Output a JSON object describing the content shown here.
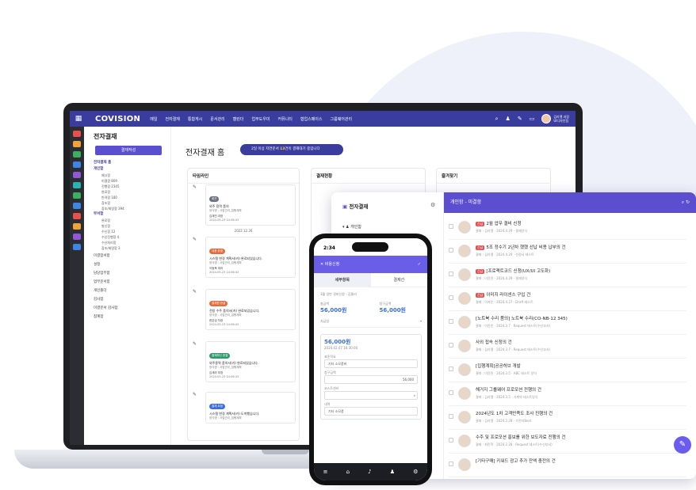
{
  "topbar": {
    "logo": "COVISION",
    "menu": [
      "메일",
      "전자결재",
      "통합게시",
      "문서관리",
      "캘린더",
      "업무도우미",
      "커뮤니티",
      "협업스페이스",
      "그룹웨어관리"
    ],
    "user_name": "김라엘 과장",
    "user_dept": "UI디자인팀"
  },
  "sidebar": {
    "title": "전자결재",
    "compose": "결재작성",
    "items": [
      {
        "label": "전자결재 홈",
        "cls": "grp"
      },
      {
        "label": "개인함",
        "cls": "grp"
      },
      {
        "label": "예고함",
        "cls": "sub"
      },
      {
        "label": "미결함 809",
        "cls": "sub"
      },
      {
        "label": "진행함 2345",
        "cls": "sub"
      },
      {
        "label": "완료함",
        "cls": "sub"
      },
      {
        "label": "반려함 180",
        "cls": "sub"
      },
      {
        "label": "참조함",
        "cls": "sub"
      },
      {
        "label": "참조/회람함 394",
        "cls": "sub"
      },
      {
        "label": "부서함",
        "cls": "grp"
      },
      {
        "label": "완료함",
        "cls": "sub"
      },
      {
        "label": "발신함",
        "cls": "sub"
      },
      {
        "label": "수신함 12",
        "cls": "sub"
      },
      {
        "label": "수신진행함 4",
        "cls": "sub"
      },
      {
        "label": "수신처리함",
        "cls": "sub"
      },
      {
        "label": "참조/회람함 3",
        "cls": "sub"
      },
      {
        "label": "미결함서함",
        "cls": ""
      },
      {
        "label": "설정",
        "cls": ""
      },
      {
        "label": "담당업무함",
        "cls": ""
      },
      {
        "label": "업무문서함",
        "cls": ""
      },
      {
        "label": "개인폴더",
        "cls": ""
      },
      {
        "label": "감사함",
        "cls": ""
      },
      {
        "label": "미결문서 감사함",
        "cls": ""
      },
      {
        "label": "참계함",
        "cls": ""
      }
    ]
  },
  "main": {
    "title": "전자결재 홈",
    "banner_pre": "2일 이상 지연문서 ",
    "banner_num": "13",
    "banner_post": "건이 결재대기 중입니다"
  },
  "timeline": {
    "title": "타임라인",
    "today": "TODAY",
    "date2": "2022.12.26",
    "items": [
      {
        "badge": "회관",
        "color": "#6b7180",
        "title": "외주 용역 품의",
        "sub": "양식명 : 사업관리_집행계획",
        "name": "김재진 과장",
        "time": "2024-05-23 14:56:43"
      },
      {
        "badge": "내용 완결",
        "color": "#e56b3c",
        "title": "시스템 변경 계획서(카) 완료되었습니다.",
        "sub": "양식명 : 사업관리_집행계획",
        "name": "이동욱 대리",
        "time": "2024-05-23 14:56:43"
      },
      {
        "badge": "결재원 완결",
        "color": "#e56b3c",
        "title": "전용 수주 품의서(카) 완료되었습니다.",
        "sub": "양식명 : 사업관리_집행계획",
        "name": "한은성 차장",
        "time": "2024-05-23 14:56:43"
      },
      {
        "badge": "결재하신 완결",
        "color": "#2e9a6c",
        "title": "외주용역 품의서(카) 완료되었습니다.",
        "sub": "양식명 : 사업관리_집행계획",
        "name": "김세라 부장",
        "time": "2024-05-23 14:56:43"
      },
      {
        "badge": "결재 요청",
        "color": "#3b6fe0",
        "title": "시스템 변경 계획서(카) 도착했습니다.",
        "sub": "양식명 : 사업관리_집행계획",
        "name": "",
        "time": ""
      }
    ]
  },
  "cards": {
    "approval": "결재현황",
    "favorites": "즐겨찾기"
  },
  "panel": {
    "left_title": "전자결재",
    "left_item": "개인함",
    "header": "개인함 - 미결함",
    "rows": [
      {
        "tag": "긴급",
        "title": "2월 업무 결비 신청",
        "meta": "결재 : 김라엘 · 2024.4.29 · 결재양식"
      },
      {
        "tag": "긴급",
        "title": "5조 정수기 2년차 했했 선납 비용 납부의 건",
        "meta": "결재 : 김라엘 · 2024.4.29 · 선정서 테스트"
      },
      {
        "tag": "긴급",
        "title": "[프로젝트코드 신청(UX/UI 고도화)",
        "meta": "결재 : 이윤민 · 2024.4.29 · 결재양식"
      },
      {
        "tag": "긴급",
        "title": "이미지 라이센스 구입 건",
        "meta": "결재 : 이지은 · 2024.4.27 · Draft 테스트"
      },
      {
        "tag": "",
        "title": "[노트북 수리 품의] 노트북 수리(CO-NB-12 345)",
        "meta": "결재 : 이윤민 · 2024.3.7 · Request 테스트(수신부서)"
      },
      {
        "tag": "",
        "title": "사외 접속 신청의 건",
        "meta": "결재 : 김라엘 · 2024.3.7 · Request 테스트(수신부서)"
      },
      {
        "tag": "",
        "title": "[집행계획]공공허브 개발",
        "meta": "결재 : 이윤민 · 2024.3.5 · ABC 테스트 양식"
      },
      {
        "tag": "",
        "title": "해거지 그룹웨어 프로모션 전행의 건",
        "meta": "결재 : 김라엘 · 2024.3.5 · 가계약 테스트양식"
      },
      {
        "tag": "",
        "title": "2024년도 1차 고객만족도 조사 진행의 건",
        "meta": "결재 : 김라엘 · 2024.2.28 · 가전지Best"
      },
      {
        "tag": "",
        "title": "수주 및 프로모션 홍보를 위한 보도자료 진행의 건",
        "meta": "결재 : 최민학 · 2024.2.28 · Request 테스트(수신부서)"
      },
      {
        "tag": "",
        "title": "[기타구매] 키워드 광고 추가 잔액 충전의 건",
        "meta": ""
      }
    ]
  },
  "phone": {
    "time": "2:34",
    "header": "비용신청",
    "tab1": "세부항목",
    "tab2": "결제선",
    "desc": "3월 일반 경비신청 - 김율리",
    "l1": "총금액",
    "v1": "56,000원",
    "l2": "청구금액",
    "v2": "56,000원",
    "l3": "지급일",
    "amount": "56,000원",
    "date": "2024.02.07 16:30:00",
    "l4": "표준적요",
    "f4": "기타 소모품비",
    "l5": "청구금액",
    "f5": "56,000",
    "l6": "코스트센터",
    "l7": "내역",
    "f7": "기타 소모품"
  }
}
